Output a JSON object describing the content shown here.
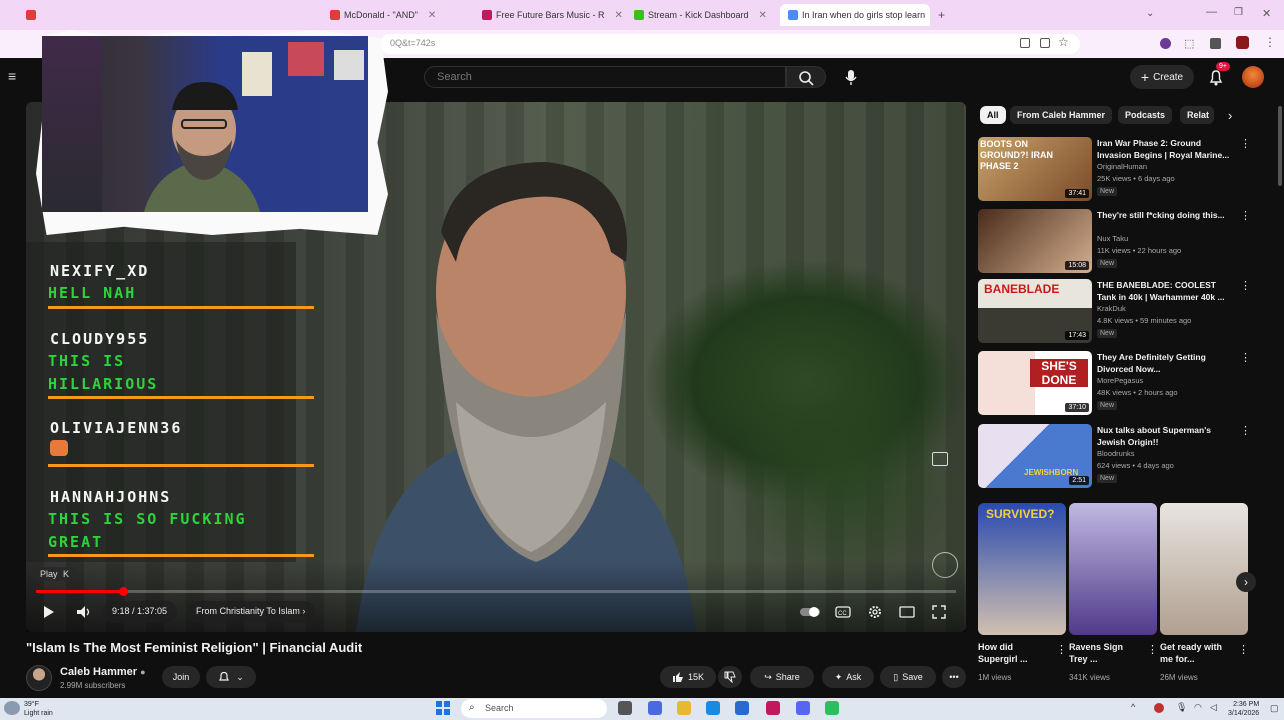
{
  "browser": {
    "tabs": [
      {
        "label": "McDonald - \"AND\"",
        "color": "#e03a3a"
      },
      {
        "label": "Free Future Bars Music - R",
        "color": "#c2185b"
      },
      {
        "label": "Stream - Kick Dashboard",
        "color": "#35c21b"
      },
      {
        "label": "In Iran when do girls stop learn",
        "color": "#4c8bf5"
      }
    ],
    "url_fragment": "0Q&t=742s"
  },
  "youtube": {
    "search_placeholder": "Search",
    "create_label": "Create",
    "notif_badge": "9+",
    "video": {
      "title": "\"Islam Is The Most Feminist Religion\" | Financial Audit",
      "time": "9:18 / 1:37:05",
      "chapter": "From Christianity To Islam",
      "progress": 0.095,
      "play_tooltip": "Play",
      "play_tooltip_key": "K"
    },
    "channel": {
      "name": "Caleb Hammer",
      "subs": "2.99M subscribers",
      "join": "Join"
    },
    "actions": {
      "likes": "15K",
      "share": "Share",
      "ask": "Ask",
      "save": "Save"
    },
    "chips": [
      "All",
      "From Caleb Hammer",
      "Podcasts",
      "Relat"
    ],
    "recommendations": [
      {
        "title": "Iran War Phase 2: Ground Invasion Begins | Royal Marine...",
        "channel": "OriginalHuman",
        "meta": "25K views • 6 days ago",
        "badge": "New",
        "duration": "37:41",
        "thumb_text": "BOOTS ON GROUND?! IRAN PHASE 2",
        "colors": [
          "#c9a36a",
          "#7a4a2a"
        ]
      },
      {
        "title": "They're still f*cking doing this...",
        "channel": "Nux Taku",
        "meta": "11K views • 22 hours ago",
        "badge": "New",
        "duration": "15:08",
        "thumb_text": "",
        "colors": [
          "#4a2a1a",
          "#d4b090"
        ]
      },
      {
        "title": "THE BANEBLADE: COOLEST Tank in 40k | Warhammer 40k ...",
        "channel": "KrakDuk",
        "meta": "4.8K views • 59 minutes ago",
        "badge": "New",
        "duration": "17:43",
        "thumb_text": "BANEBLADE",
        "colors": [
          "#e8e6dc",
          "#3a3a32"
        ]
      },
      {
        "title": "They Are Definitely Getting Divorced Now...",
        "channel": "MorePegasus",
        "meta": "48K views • 2 hours ago",
        "badge": "New",
        "duration": "37:10",
        "thumb_text": "SHE'S DONE",
        "colors": [
          "#f4e0d8",
          "#b02020"
        ]
      },
      {
        "title": "Nux talks about Superman's Jewish Origin!!",
        "channel": "Bloodrunks",
        "meta": "624 views • 4 days ago",
        "badge": "New",
        "duration": "2:51",
        "thumb_text": "JEWISHBORN",
        "colors": [
          "#4a7ad0",
          "#f0d040"
        ]
      }
    ],
    "shorts": [
      {
        "title": "How did Supergirl ...",
        "views": "1M views",
        "thumb_text": "SURVIVED?",
        "colors": [
          "#2a4ab0",
          "#d0c0b0"
        ]
      },
      {
        "title": "Ravens Sign Trey ...",
        "views": "341K views",
        "thumb_text": "",
        "colors": [
          "#c0b8e0",
          "#503a8a"
        ]
      },
      {
        "title": "Get ready with me for...",
        "views": "26M views",
        "thumb_text": "",
        "colors": [
          "#e8e4e0",
          "#b0a090"
        ]
      }
    ]
  },
  "stream_chat": [
    {
      "user": "NEXIFY_XD",
      "message": "HELL NAH"
    },
    {
      "user": "CLOUDY955",
      "message": "THIS IS HILLARIOUS"
    },
    {
      "user": "OLIVIAJENN36",
      "message": ""
    },
    {
      "user": "HANNAHJOHNS",
      "message": "THIS IS SO FUCKING GREAT"
    }
  ],
  "taskbar": {
    "weather_temp": "39°F",
    "weather_desc": "Light rain",
    "search_placeholder": "Search",
    "time": "2:36 PM",
    "date": "3/14/2026"
  }
}
